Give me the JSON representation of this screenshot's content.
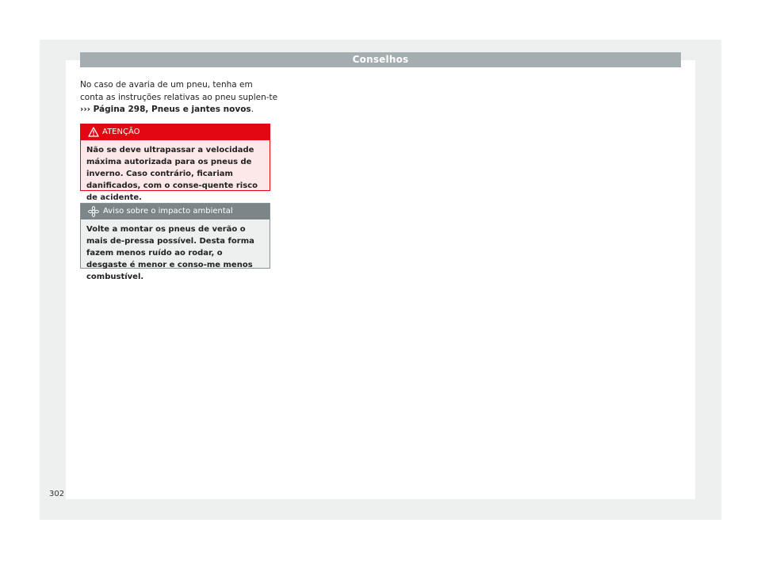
{
  "header": {
    "title": "Conselhos"
  },
  "intro": {
    "text": "No caso de avaria de um pneu, tenha em conta as instruções relativas ao pneu suplen-te ",
    "ref_arrow": "›››",
    "ref_text": " Página 298, Pneus e jantes novos",
    "end": "."
  },
  "warning": {
    "icon": "warning-triangle-icon",
    "title": "ATENÇÃO",
    "text": "Não se deve ultrapassar a velocidade máxima autorizada para os pneus de inverno. Caso contrário, ficariam danificados, com o conse-quente risco de acidente."
  },
  "environment": {
    "icon": "leaf-icon",
    "title": "Aviso sobre o impacto ambiental",
    "text": "Volte a montar os pneus de verão o mais de-pressa possível. Desta forma fazem menos ruído ao rodar, o desgaste é menor e conso-me menos combustível."
  },
  "footer": {
    "page_number": "302"
  },
  "colors": {
    "warning": "#e30613",
    "header": "#a4adaf",
    "env_header": "#7c8588"
  }
}
